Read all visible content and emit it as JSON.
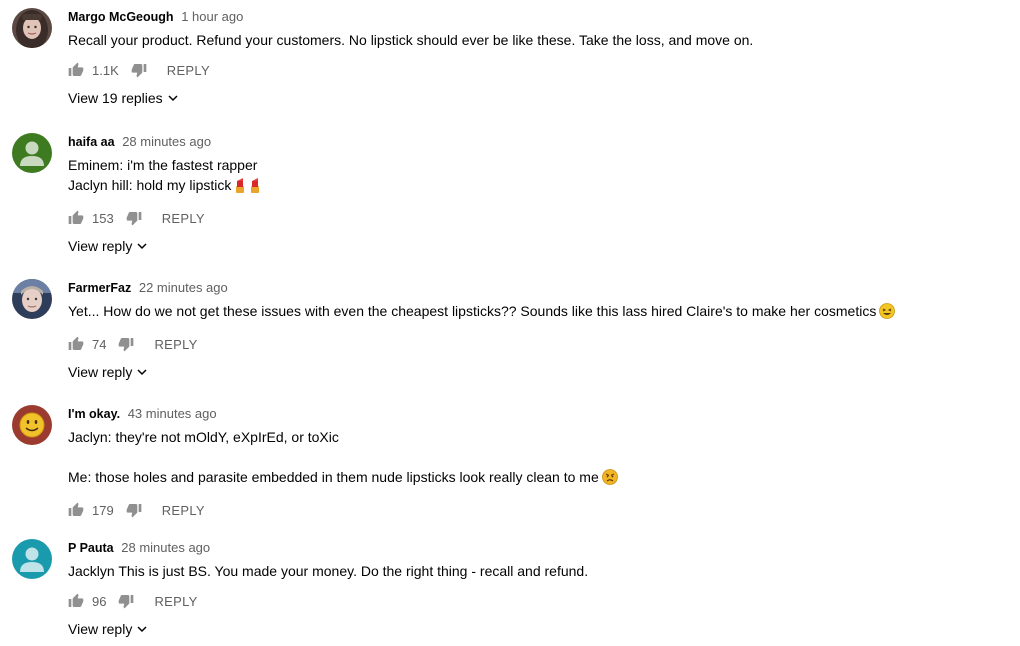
{
  "comments": [
    {
      "author": "Margo McGeough",
      "time": "1 hour ago",
      "lines": [
        "Recall your product. Refund your customers. No lipstick should ever be like these. Take the loss, and move on."
      ],
      "likes": "1.1K",
      "reply_label": "REPLY",
      "view_replies": "View 19 replies",
      "avatar": "photo-woman-avatar"
    },
    {
      "author": "haifa aa",
      "time": "28 minutes ago",
      "lines": [
        "Eminem: i'm the fastest rapper",
        "Jaclyn hill: hold my lipstick"
      ],
      "likes": "153",
      "reply_label": "REPLY",
      "view_replies": "View reply",
      "avatar": "default-green-avatar"
    },
    {
      "author": "FarmerFaz",
      "time": "22 minutes ago",
      "lines": [
        "Yet... How do we not get these issues with even the cheapest lipsticks?? Sounds like this lass hired Claire's to make her cosmetics"
      ],
      "likes": "74",
      "reply_label": "REPLY",
      "view_replies": "View reply",
      "avatar": "photo-man-avatar"
    },
    {
      "author": "I'm okay.",
      "time": "43 minutes ago",
      "lines": [
        "Jaclyn: they're not mOldY, eXpIrEd, or toXic",
        "",
        "Me: those holes and parasite embedded in them nude lipsticks look really clean to me"
      ],
      "likes": "179",
      "reply_label": "REPLY",
      "view_replies": "",
      "avatar": "smiley-avatar"
    },
    {
      "author": "P Pauta",
      "time": "28 minutes ago",
      "lines": [
        "Jacklyn This is just BS. You made your money. Do the right thing - recall and refund."
      ],
      "likes": "96",
      "reply_label": "REPLY",
      "view_replies": "View reply",
      "avatar": "default-teal-avatar"
    }
  ],
  "colors": {
    "author": "#030303",
    "meta": "#606060",
    "green_avatar": "#3d7a20",
    "teal_avatar": "#1a9aad"
  },
  "icons": [
    "thumb-up-icon",
    "thumb-down-icon",
    "chevron-down-icon",
    "lipstick-emoji-icon",
    "laughing-emoji-icon",
    "angry-emoji-icon"
  ]
}
